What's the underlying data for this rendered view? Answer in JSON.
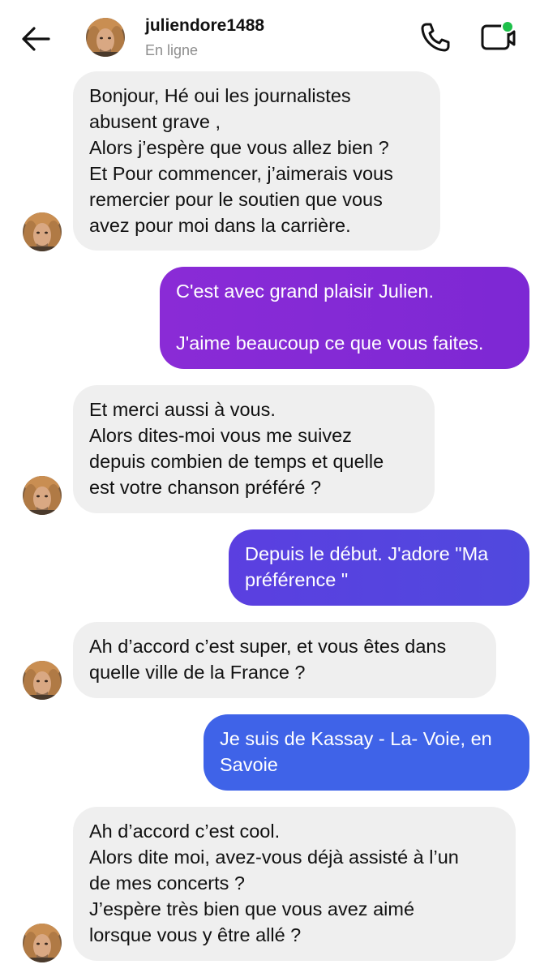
{
  "header": {
    "username": "juliendore1488",
    "status": "En ligne",
    "icons": {
      "back": "back-arrow-icon",
      "call": "phone-icon",
      "video": "video-call-icon"
    },
    "online_dot_color": "#1ec04a"
  },
  "messages": [
    {
      "direction": "incoming",
      "text": "Bonjour, Hé oui les journalistes\nabusent grave ,\nAlors j’espère que vous allez bien ?\nEt Pour commencer, j’aimerais vous\nremercier pour le soutien que vous\navez pour moi dans la carrière."
    },
    {
      "direction": "outgoing",
      "text": "C'est avec grand plaisir Julien.\n\nJ'aime beaucoup ce que vous faites."
    },
    {
      "direction": "incoming",
      "text": "Et merci aussi à vous.\nAlors dites-moi vous me suivez\ndepuis combien de temps et quelle\nest votre chanson préféré ?"
    },
    {
      "direction": "outgoing",
      "text": "Depuis le début. J'adore \"Ma\npréférence \""
    },
    {
      "direction": "incoming",
      "text": "Ah d’accord c’est super, et vous êtes dans\nquelle ville de la France ?"
    },
    {
      "direction": "outgoing",
      "text": "Je suis de Kassay - La- Voie, en\nSavoie"
    },
    {
      "direction": "incoming",
      "text": "Ah d’accord c’est cool.\n Alors dite moi, avez-vous déjà assisté à l’un\nde mes concerts ?\nJ’espère très bien que vous avez aimé\nlorsque vous y être allé ?"
    }
  ],
  "colors": {
    "incoming_bubble": "#efefef",
    "outgoing_purple": "#8a2bd6",
    "outgoing_indigo": "#5b3fe0",
    "outgoing_blue": "#3f63e8"
  }
}
